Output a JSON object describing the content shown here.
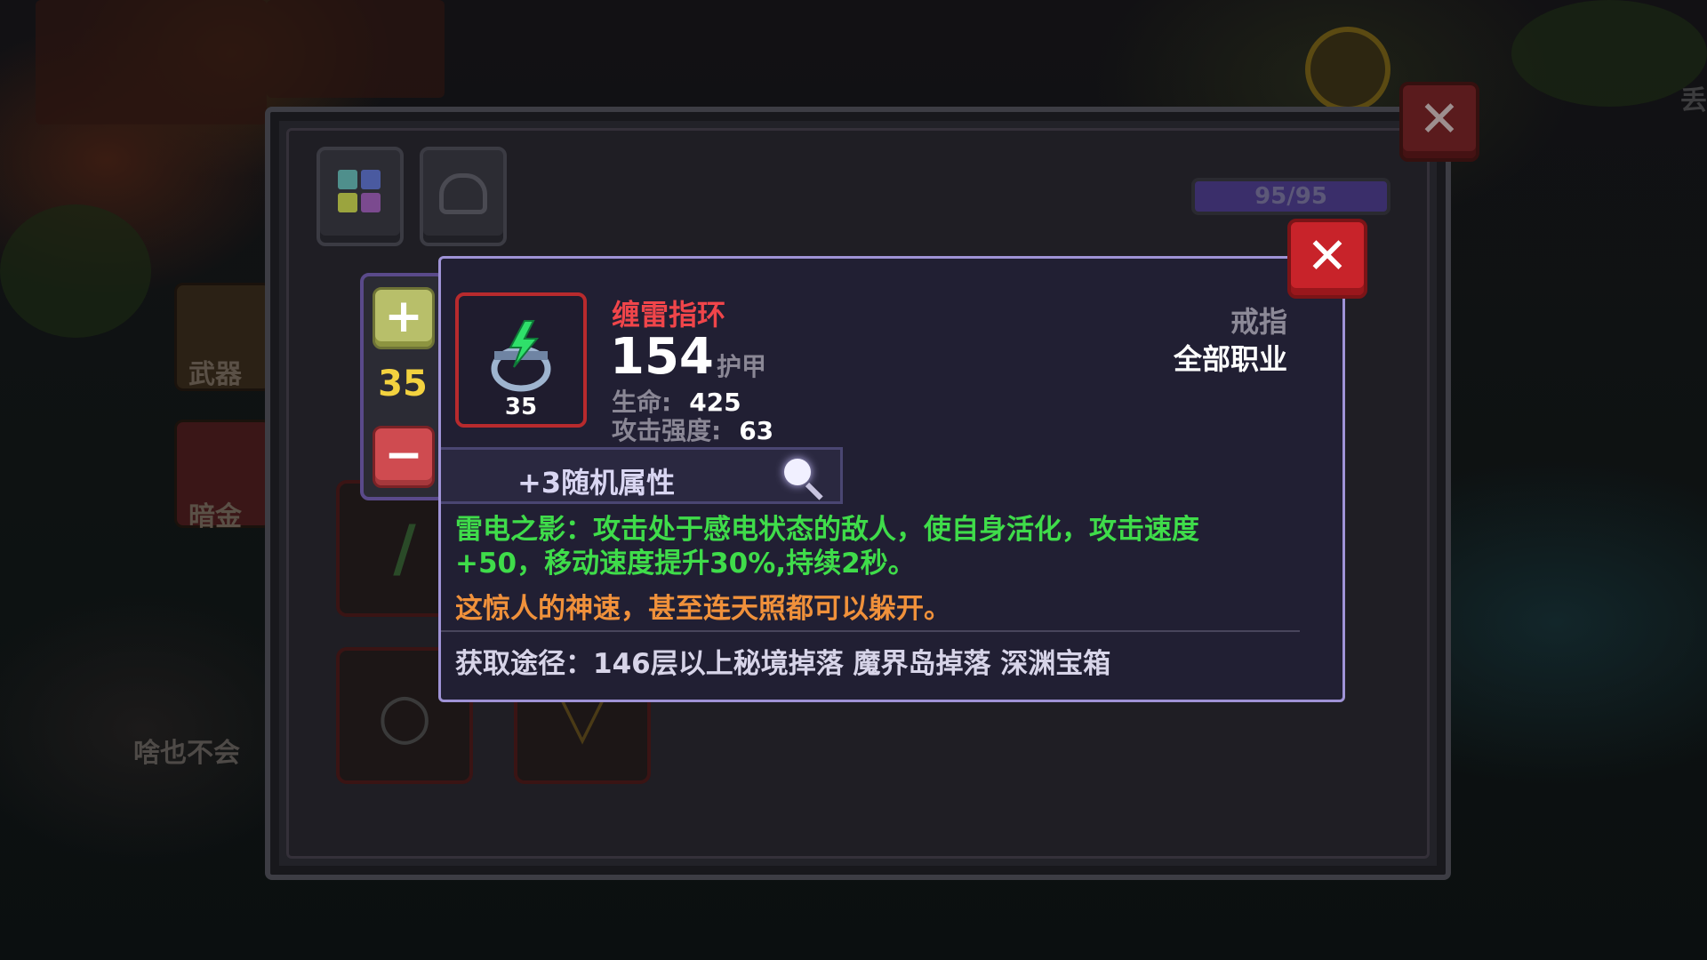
{
  "background": {
    "side_labels": [
      "武器",
      "暗金"
    ],
    "caption": "啥也不会",
    "corner_text": "丢"
  },
  "panel": {
    "capacity": "95/95",
    "stepper": {
      "value": "35"
    }
  },
  "tooltip": {
    "item_name": "缠雷指环",
    "item_level": "35",
    "armor_value": "154",
    "armor_label": "护甲",
    "stats": [
      {
        "label": "生命:",
        "value": "425"
      },
      {
        "label": "攻击强度:",
        "value": "63"
      }
    ],
    "item_type": "戒指",
    "item_class": "全部职业",
    "random_attributes": "+3随机属性",
    "effect_line1": "雷电之影：攻击处于感电状态的敌人，使自身活化，攻击速度",
    "effect_line2": "+50，移动速度提升30%,持续2秒。",
    "flavor": "这惊人的神速，甚至连天照都可以躲开。",
    "source": "获取途径：146层以上秘境掉落 魔界岛掉落 深渊宝箱"
  },
  "colors": {
    "item_name": "#f0454a",
    "effect": "#3fdc4a",
    "flavor": "#f0913b",
    "stepper_value": "#f3d23f",
    "close_button": "#c8232a"
  },
  "icons": {
    "close": "close-icon",
    "plus": "plus-icon",
    "minus": "minus-icon",
    "magnify": "magnify-icon",
    "ring": "lightning-ring-icon"
  }
}
